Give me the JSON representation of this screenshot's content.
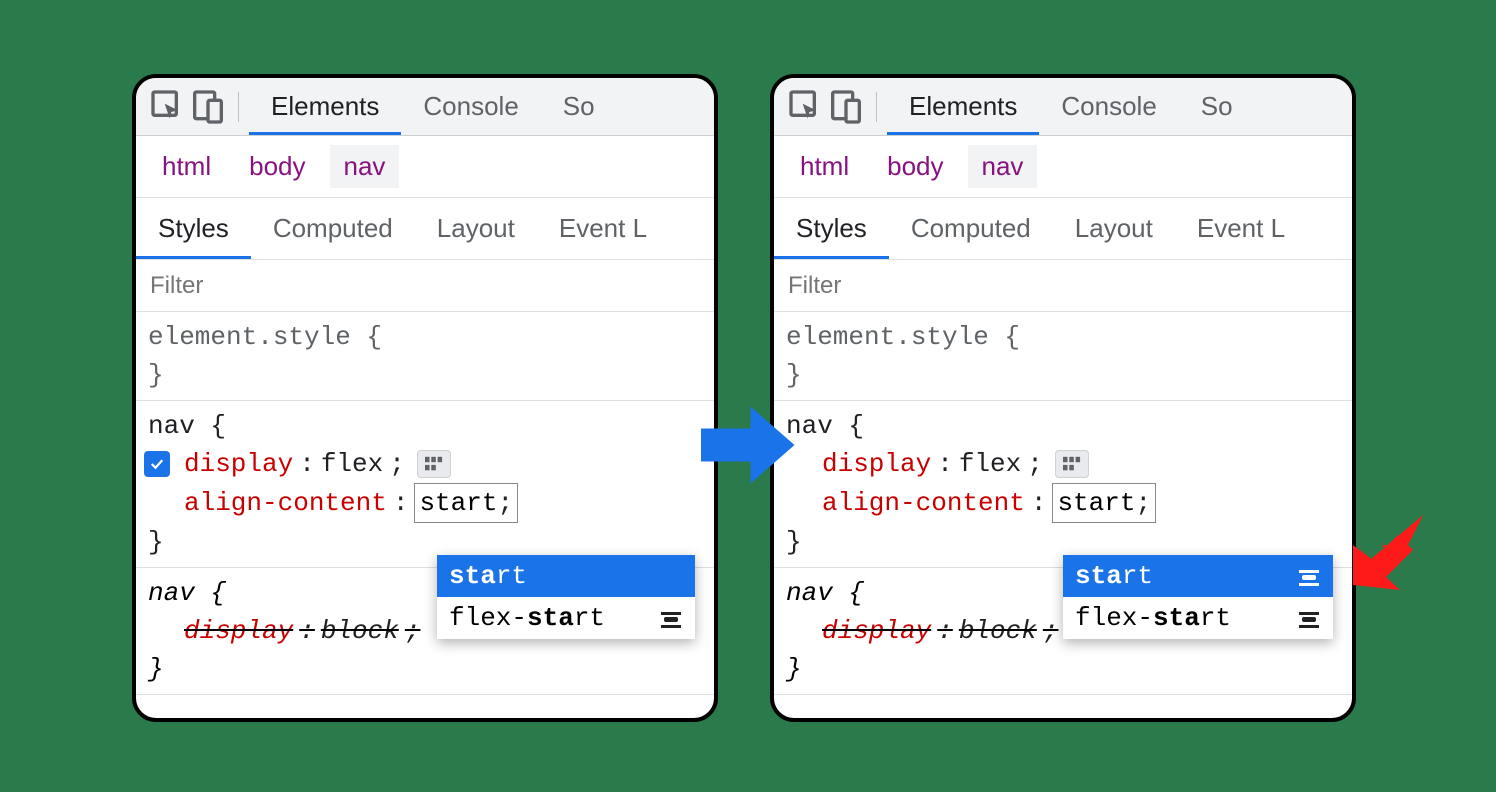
{
  "toolbar": {
    "tabs": [
      "Elements",
      "Console",
      "So"
    ]
  },
  "breadcrumb": [
    "html",
    "body",
    "nav"
  ],
  "subtabs": [
    "Styles",
    "Computed",
    "Layout",
    "Event L"
  ],
  "filter": {
    "placeholder": "Filter"
  },
  "rules": {
    "elementStyle": {
      "selector": "element.style {",
      "close": "}"
    },
    "nav": {
      "selector": "nav {",
      "display": {
        "name": "display",
        "value": "flex"
      },
      "alignContent": {
        "name": "align-content",
        "value": "start"
      },
      "close": "}"
    },
    "navUA": {
      "selector": "nav {",
      "display": {
        "name": "display",
        "value": "block"
      },
      "close": "}"
    }
  },
  "autocomplete": {
    "items": [
      {
        "bold": "sta",
        "rest": "rt",
        "selected": true,
        "hasIconLeft": false,
        "hasIconRight": true
      },
      {
        "prefix": "flex-",
        "bold": "sta",
        "rest": "rt",
        "selected": false,
        "hasIcon": true
      }
    ]
  },
  "colors": {
    "accent": "#1a73e8",
    "propName": "#c80000",
    "crumb": "#881280"
  }
}
